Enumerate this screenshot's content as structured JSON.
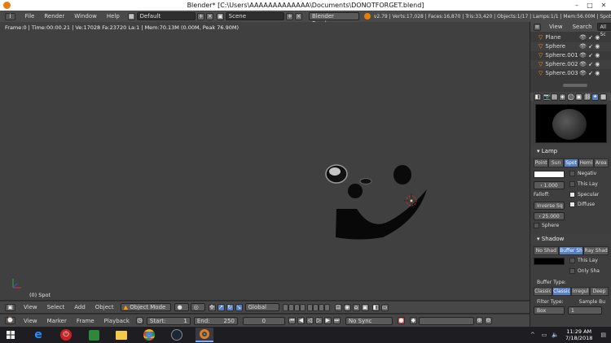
{
  "window": {
    "title": "Blender* [C:\\Users\\AAAAAAAAAAAAA\\Documents\\DONOTFORGET.blend]"
  },
  "info_header": {
    "menus": [
      "File",
      "Render",
      "Window",
      "Help"
    ],
    "screen": "Default",
    "scene": "Scene",
    "engine": "Blender Render",
    "stats": "v2.79 | Verts:17,028 | Faces:16,870 | Tris:33,420 | Objects:1/17 | Lamps:1/1 | Mem:56.00M | Spot"
  },
  "viewport": {
    "info": "Frame:0 | Time:00:00.21 | Ve:17028 Fa:23720 La:1 | Mem:70.13M (0.00M, Peak 76.90M)",
    "object": "(0) Spot"
  },
  "view_header": {
    "menus": [
      "View",
      "Select",
      "Add",
      "Object"
    ],
    "mode": "Object Mode",
    "orientation": "Global"
  },
  "timeline": {
    "menus": [
      "View",
      "Marker",
      "Frame",
      "Playback"
    ],
    "start_label": "Start:",
    "start": "1",
    "end_label": "End:",
    "end": "250",
    "current": "0",
    "sync": "No Sync"
  },
  "outliner": {
    "view": "View",
    "search": "Search",
    "all": "All Sc",
    "items": [
      "Plane",
      "Sphere",
      "Sphere.001",
      "Sphere.002",
      "Sphere.003"
    ]
  },
  "properties": {
    "lamp_section": "Lamp",
    "lamp_types": [
      "Point",
      "Sun",
      "Spot",
      "Hemi",
      "Area"
    ],
    "lamp_active": "Spot",
    "negative": "Negativ",
    "this_layer": "This Lay",
    "energy": "1.000",
    "falloff_label": "Falloff:",
    "falloff": "Inverse Sq",
    "specular": "Specular",
    "diffuse": "Diffuse",
    "distance": "25.000",
    "sphere": "Sphere",
    "shadow_section": "Shadow",
    "shadow_types": [
      "No Shad",
      "Buffer Sh",
      "Ray Shad"
    ],
    "shadow_active": "Buffer Sh",
    "shadow_this_layer": "This Lay",
    "only_shadow": "Only Sha",
    "buffer_type_label": "Buffer Type:",
    "buffer_types": [
      "Classic",
      "Classic",
      "Irregul",
      "Deep"
    ],
    "filter_type_label": "Filter Type:",
    "sample_buffers_label": "Sample Bu",
    "filter_type": "Box",
    "sample_buffers": "1"
  },
  "taskbar": {
    "time": "11:29 AM",
    "date": "7/18/2018"
  },
  "colors": {
    "accent": "#5680c2",
    "viewport_bg": "#404040",
    "header_bg": "#4a4a4a"
  }
}
